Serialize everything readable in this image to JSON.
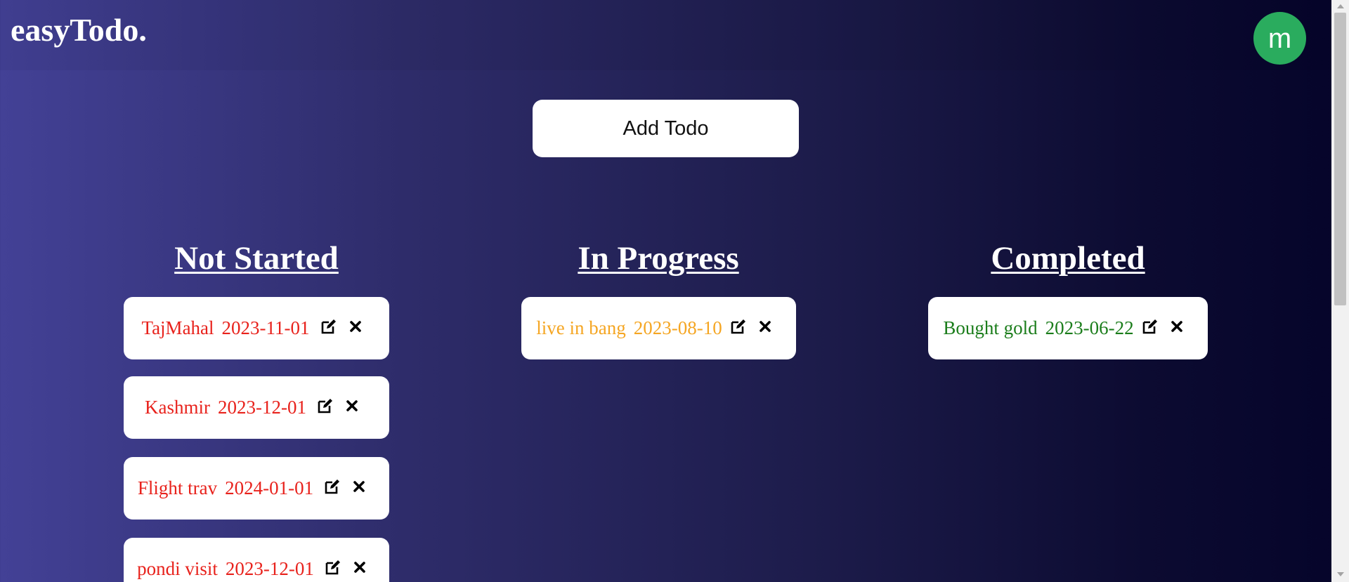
{
  "app": {
    "brand": "easyTodo.",
    "avatar_initial": "m",
    "avatar_color": "#2aac5e",
    "add_button_label": "Add Todo"
  },
  "columns": [
    {
      "title": "Not Started",
      "color": "#e8221c",
      "items": [
        {
          "name": "TajMahal",
          "date": "2023-11-01"
        },
        {
          "name": "Kashmir",
          "date": "2023-12-01"
        },
        {
          "name": "Flight trav",
          "date": "2024-01-01"
        },
        {
          "name": "pondi visit",
          "date": "2023-12-01"
        }
      ]
    },
    {
      "title": "In Progress",
      "color": "#f5a623",
      "items": [
        {
          "name": "live in bang",
          "date": "2023-08-10"
        }
      ]
    },
    {
      "title": "Completed",
      "color": "#1b7d1b",
      "items": [
        {
          "name": "Bought gold",
          "date": "2023-06-22"
        }
      ]
    }
  ],
  "icons": {
    "edit": "edit-icon",
    "delete": "close-icon"
  }
}
